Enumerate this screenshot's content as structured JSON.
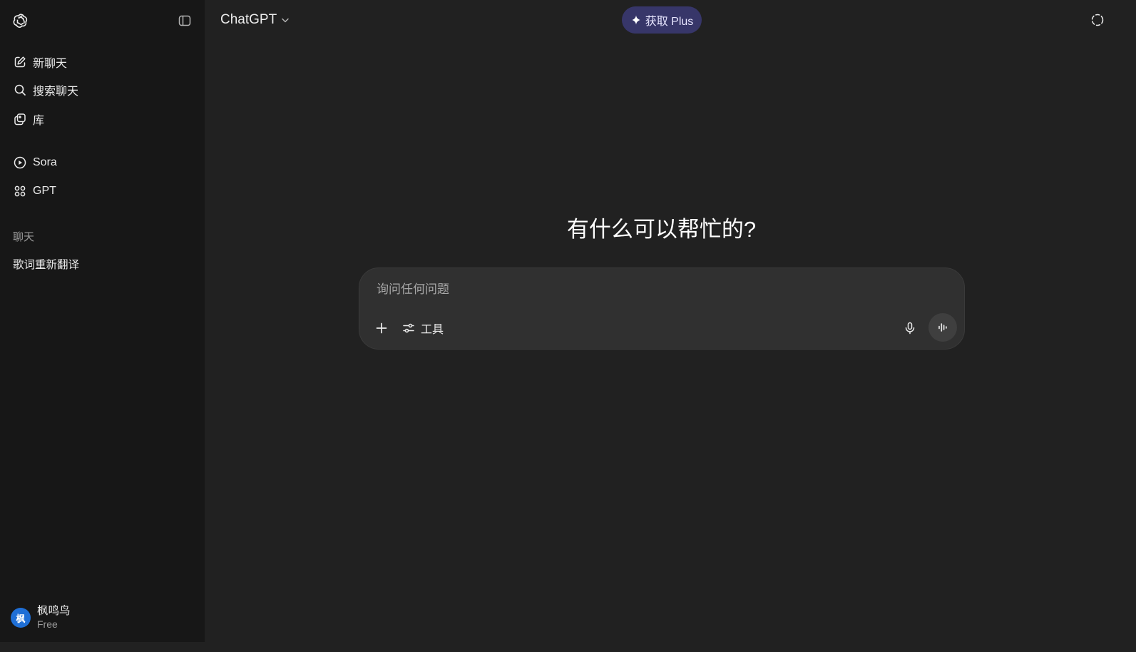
{
  "sidebar": {
    "logo_icon": "openai-logo-icon",
    "toggle_icon": "sidebar-toggle-icon",
    "nav": [
      {
        "label": "新聊天",
        "icon": "compose-icon"
      },
      {
        "label": "搜索聊天",
        "icon": "search-icon"
      },
      {
        "label": "库",
        "icon": "library-icon"
      },
      {
        "label": "Sora",
        "icon": "play-circle-icon"
      },
      {
        "label": "GPT",
        "icon": "grid-icon"
      }
    ],
    "section_label": "聊天",
    "chats": [
      {
        "title": "歌词重新翻译"
      }
    ],
    "user": {
      "avatar_text": "枫",
      "name": "枫鸣鸟",
      "plan": "Free"
    }
  },
  "header": {
    "model_name": "ChatGPT",
    "upgrade_label": "获取 Plus",
    "temporary_chat_icon": "temporary-chat-icon"
  },
  "main": {
    "headline": "有什么可以帮忙的?",
    "composer": {
      "placeholder": "询问任何问题",
      "tools_label": "工具"
    }
  },
  "colors": {
    "sidebar_bg": "#171717",
    "main_bg": "#212121",
    "composer_bg": "#303030",
    "plus_button_bg": "#373669",
    "avatar_bg": "#1f6fd6"
  }
}
